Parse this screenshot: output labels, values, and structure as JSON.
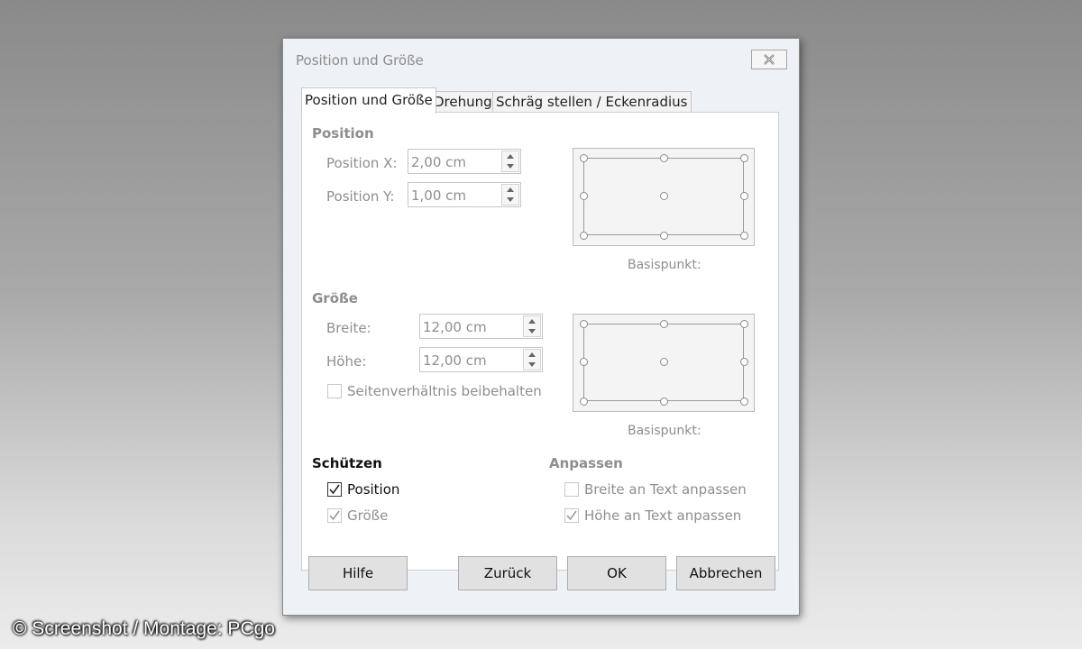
{
  "dialog": {
    "title": "Position und Größe",
    "tabs": [
      {
        "label": "Position und Größe",
        "active": true
      },
      {
        "label": "Drehung",
        "active": false
      },
      {
        "label": "Schräg stellen / Eckenradius",
        "active": false
      }
    ]
  },
  "position": {
    "heading": "Position",
    "x_label": "Position X:",
    "x_value": "2,00 cm",
    "y_label": "Position Y:",
    "y_value": "1,00 cm",
    "basis_label": "Basispunkt:"
  },
  "size": {
    "heading": "Größe",
    "width_label": "Breite:",
    "width_value": "12,00 cm",
    "height_label": "Höhe:",
    "height_value": "12,00 cm",
    "keep_ratio_label": "Seitenverhältnis beibehalten",
    "keep_ratio_checked": false,
    "basis_label": "Basispunkt:"
  },
  "protect": {
    "heading": "Schützen",
    "position_label": "Position",
    "position_checked": true,
    "size_label": "Größe",
    "size_checked": true
  },
  "adapt": {
    "heading": "Anpassen",
    "width_label": "Breite an Text anpassen",
    "width_checked": false,
    "height_label": "Höhe an Text anpassen",
    "height_checked": true
  },
  "buttons": {
    "help": "Hilfe",
    "back": "Zurück",
    "ok": "OK",
    "cancel": "Abbrechen"
  },
  "watermark": "© Screenshot / Montage: PCgo",
  "icons": {
    "close": "close-icon",
    "spin_up": "triangle-up-icon",
    "spin_down": "triangle-down-icon",
    "check": "checkmark-icon"
  }
}
